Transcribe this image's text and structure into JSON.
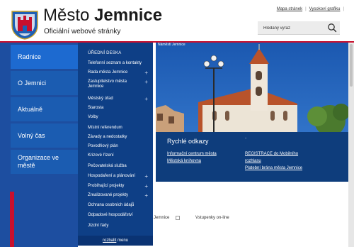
{
  "header": {
    "title_regular": "Město",
    "title_bold": "Jemnice",
    "subtitle": "Oficiální webové stránky",
    "links": [
      "Mapa stránek",
      "Vysokoví grafiku"
    ],
    "search_placeholder": "Hledaný výraz"
  },
  "nav": {
    "items": [
      {
        "label": "Radnice",
        "active": true
      },
      {
        "label": "O Jemnici",
        "active": false
      },
      {
        "label": "Aktuálně",
        "active": false
      },
      {
        "label": "Volný čas",
        "active": false
      },
      {
        "label": "Organizace ve městě",
        "active": false
      }
    ]
  },
  "submenu": {
    "heading": "ÚŘEDNÍ DESKA",
    "items": [
      {
        "label": "Telefonní seznam a kontakty",
        "expandable": false
      },
      {
        "label": "Rada města Jemnice",
        "expandable": true
      },
      {
        "label": "Zastupitelstvo města Jemnice",
        "expandable": true
      },
      {
        "label": "Městský úřad",
        "expandable": true
      },
      {
        "label": "Starosta",
        "expandable": false
      },
      {
        "label": "Volby",
        "expandable": false
      },
      {
        "label": "Místní referendum",
        "expandable": false
      },
      {
        "label": "Závady a nedostatky",
        "expandable": false
      },
      {
        "label": "Povodňový plán",
        "expandable": false
      },
      {
        "label": "Krizové řízení",
        "expandable": false
      },
      {
        "label": "Pečovatelská služba",
        "expandable": false
      },
      {
        "label": "Hospodaření a plánování",
        "expandable": true
      },
      {
        "label": "Probíhající projekty",
        "expandable": true
      },
      {
        "label": "Zrealizované projekty",
        "expandable": true
      },
      {
        "label": "Ochrana osobních údajů",
        "expandable": false
      },
      {
        "label": "Odpadové hospodářství",
        "expandable": false
      },
      {
        "label": "Jízdní řády",
        "expandable": false
      }
    ],
    "collapse_link": "rozbalit",
    "collapse_suffix": " menu"
  },
  "hero": {
    "alt_text": "Náměstí Jemnice"
  },
  "quick_links": {
    "title": "Rychlé odkazy",
    "dot": ".",
    "links": [
      "Informační centrum města",
      "Městská knihovna",
      "REGISTRACE do Mobilního",
      "rozhlasu",
      "Platební brána města Jemnice"
    ]
  },
  "lower": {
    "text1": "Jemnice",
    "text2": "Vstupenky on-line"
  },
  "colors": {
    "nav_bg": "#1d4ea0",
    "nav_item": "#1b5cb1",
    "submenu_bg": "#0e3f86",
    "quick_bg": "#0e3d7c",
    "accent_red": "#c8102e"
  }
}
